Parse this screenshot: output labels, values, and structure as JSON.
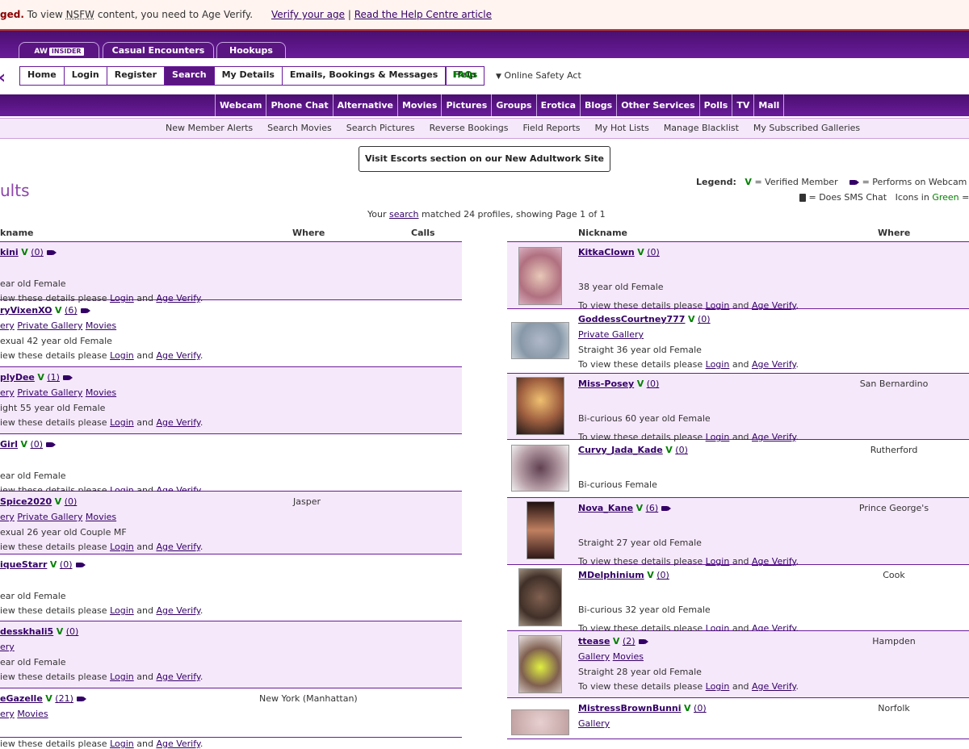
{
  "notice": {
    "prefix": "ged.",
    "text1": "To view",
    "nsfw": "NSFW",
    "text2": "content, you need to Age Verify.",
    "verify_link": "Verify your age",
    "sep": "|",
    "help_link": "Read the Help Centre article"
  },
  "top_tabs": {
    "aw_insider_prefix": "AW",
    "aw_insider_badge": "INSIDER",
    "casual": "Casual Encounters",
    "hookups": "Hookups"
  },
  "main_nav": [
    {
      "label": "Home",
      "active": false
    },
    {
      "label": "Login",
      "active": false
    },
    {
      "label": "Register",
      "active": false
    },
    {
      "label": "Search",
      "active": true
    },
    {
      "label": "My Details",
      "active": false
    },
    {
      "label": "Emails, Bookings & Messages",
      "active": false
    },
    {
      "label": "Help",
      "active": false
    }
  ],
  "faqs": "FAQs",
  "online_safety": "Online Safety Act",
  "categories": [
    "Webcam",
    "Phone Chat",
    "Alternative",
    "Movies",
    "Pictures",
    "Groups",
    "Erotica",
    "Blogs",
    "Other Services",
    "Polls",
    "TV",
    "Mall"
  ],
  "sub_links": [
    "New Member Alerts",
    "Search Movies",
    "Search Pictures",
    "Reverse Bookings",
    "Field Reports",
    "My Hot Lists",
    "Manage Blacklist",
    "My Subscribed Galleries"
  ],
  "escorts_button": "Visit Escorts section on our New Adultwork Site",
  "legend": {
    "label": "Legend:",
    "v": "V",
    "verified": "= Verified Member",
    "webcam": "= Performs on Webcam",
    "sms": "= Does SMS Chat",
    "icons_in": "Icons in",
    "green_word": "Green",
    "tail": "= A"
  },
  "title": "ults",
  "summary": {
    "pre": "Your",
    "search": "search",
    "post": "matched 24 profiles, showing Page 1 of 1"
  },
  "left_headers": {
    "nickname": "kname",
    "where": "Where",
    "calls": "Calls"
  },
  "right_headers": {
    "nickname": "Nickname",
    "where": "Where"
  },
  "common": {
    "details_pre": "To view these details please",
    "details_pre_cut": "iew these details please",
    "login": "Login",
    "and": "and",
    "age_verify": "Age Verify",
    "dot": "."
  },
  "left_rows": [
    {
      "nick": "kini",
      "count": "(0)",
      "cam": true,
      "links": [],
      "desc": "ear old Female",
      "where": ""
    },
    {
      "nick": "ryVixenXO",
      "count": "(6)",
      "cam": true,
      "links": [
        "ery",
        "Private Gallery",
        "Movies"
      ],
      "desc": "exual 42 year old Female",
      "where": ""
    },
    {
      "nick": "plyDee",
      "count": "(1)",
      "cam": true,
      "links": [
        "ery",
        "Private Gallery",
        "Movies"
      ],
      "desc": "ight 55 year old Female",
      "where": ""
    },
    {
      "nick": "Girl",
      "count": "(0)",
      "cam": true,
      "links": [],
      "desc": "ear old Female",
      "where": ""
    },
    {
      "nick": "Spice2020",
      "count": "(0)",
      "cam": false,
      "links": [
        "ery",
        "Private Gallery",
        "Movies"
      ],
      "desc": "exual 26 year old Couple MF",
      "where": "Jasper"
    },
    {
      "nick": "iqueStarr",
      "count": "(0)",
      "cam": true,
      "links": [],
      "desc": "ear old Female",
      "where": ""
    },
    {
      "nick": "desskhali5",
      "count": "(0)",
      "cam": false,
      "links": [
        "ery"
      ],
      "desc": "ear old Female",
      "where": ""
    },
    {
      "nick": "eGazelle",
      "count": "(21)",
      "cam": true,
      "links": [
        "ery",
        "Movies"
      ],
      "desc": "",
      "where": "New York (Manhattan)"
    }
  ],
  "right_rows": [
    {
      "nick": "KitkaClown",
      "count": "(0)",
      "cam": false,
      "links": [],
      "desc": "38 year old Female",
      "where": ""
    },
    {
      "nick": "GoddessCourtney777",
      "count": "(0)",
      "cam": false,
      "links": [
        "Private Gallery"
      ],
      "desc": "Straight 36 year old Female",
      "where": ""
    },
    {
      "nick": "Miss-Posey",
      "count": "(0)",
      "cam": false,
      "links": [],
      "desc": "Bi-curious 60 year old Female",
      "where": "San Bernardino"
    },
    {
      "nick": "Curvy_Jada_Kade",
      "count": "(0)",
      "cam": false,
      "links": [],
      "desc": "Bi-curious Female",
      "where": "Rutherford"
    },
    {
      "nick": "Nova_Kane",
      "count": "(6)",
      "cam": true,
      "links": [],
      "desc": "Straight 27 year old Female",
      "where": "Prince George's"
    },
    {
      "nick": "MDelphinium",
      "count": "(0)",
      "cam": false,
      "links": [],
      "desc": "Bi-curious 32 year old Female",
      "where": "Cook"
    },
    {
      "nick": "ttease",
      "count": "(2)",
      "cam": true,
      "links": [
        "Gallery",
        "Movies"
      ],
      "desc": "Straight 28 year old Female",
      "where": "Hampden"
    },
    {
      "nick": "MistressBrownBunni",
      "count": "(0)",
      "cam": false,
      "links": [
        "Gallery"
      ],
      "desc": "",
      "where": "Norfolk"
    }
  ],
  "colors": {
    "purple": "#5b1583",
    "link": "#330066",
    "green": "#008000",
    "row_alt": "#f6e8fb"
  }
}
